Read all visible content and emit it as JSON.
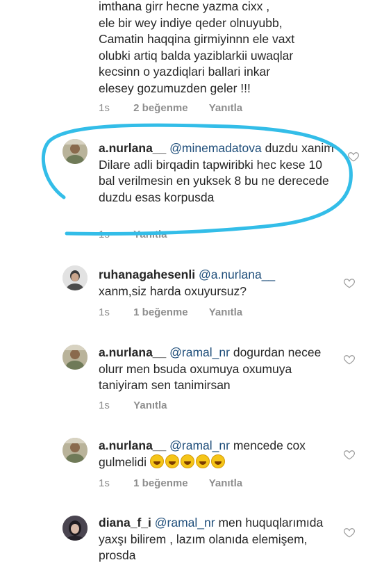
{
  "comments": [
    {
      "lines": [
        "imthana girr  hecne yazma cixx ,",
        "ele bir wey indiye qeder olnuyubb,",
        "Camatin haqqina girmiyinnn  ele vaxt",
        "olubki artiq balda yaziblarkii uwaqlar",
        "kecsinn o yazdiqlari ballari inkar",
        "elesey gozumuzden geler !!!"
      ],
      "time": "1s",
      "likes": "2 beğenme",
      "reply": "Yanıtla"
    },
    {
      "username": "a.nurlana__",
      "mention": "@minemadatova",
      "text": " duzdu xanim Dilare adli birqadin  tapwiribki hec kese 10 bal verilmesin en yuksek 8 bu ne derecede duzdu  esas korpusda",
      "time": "1s",
      "reply": "Yanıtla"
    },
    {
      "username": "ruhanagahesenli",
      "mention": "@a.nurlana__",
      "text": " xanm,siz harda oxuyursuz?",
      "time": "1s",
      "likes": "1 beğenme",
      "reply": "Yanıtla"
    },
    {
      "username": "a.nurlana__",
      "mention": "@ramal_nr",
      "text": " dogurdan necee olurr men bsuda oxumuya oxumuya taniyiram sen tanimirsan",
      "time": "1s",
      "reply": "Yanıtla"
    },
    {
      "username": "a.nurlana__",
      "mention": "@ramal_nr",
      "text": " mencede cox gulmelidi ",
      "time": "1s",
      "likes": "1 beğenme",
      "reply": "Yanıtla"
    },
    {
      "username": "diana_f_i",
      "mention": "@ramal_nr",
      "text": " men huquqlarımıda yaxşı bilirem , lazım olanıda elemişem, prosda"
    }
  ],
  "icons": {
    "heart": "heart-outline-icon",
    "emoji": "laughing-face-icon"
  },
  "colors": {
    "annotation_oval": "#33bde8",
    "mention": "#1f4e7a",
    "meta": "#8e8e8e"
  }
}
